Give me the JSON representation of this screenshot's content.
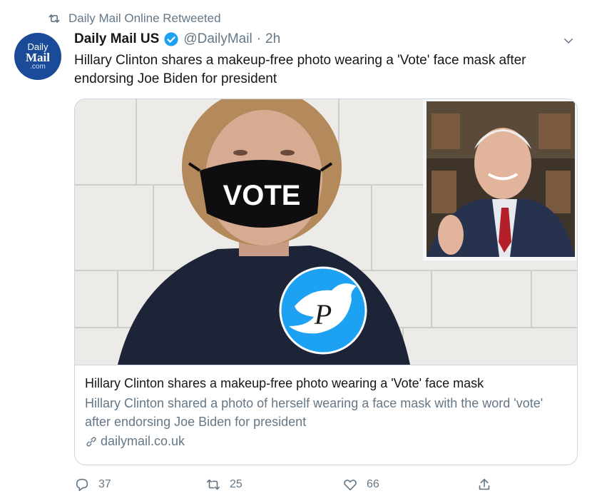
{
  "retweet": {
    "label": "Daily Mail Online Retweeted"
  },
  "avatar": {
    "line1": "Daily",
    "line2": "Mail",
    "line3": ".com"
  },
  "tweet": {
    "author_name": "Daily Mail US",
    "handle": "@DailyMail",
    "separator": "·",
    "time": "2h",
    "text": "Hillary Clinton shares a makeup-free photo wearing a 'Vote' face mask after endorsing Joe Biden for president"
  },
  "card": {
    "title": "Hillary Clinton shares a makeup-free photo wearing a 'Vote' face mask",
    "description": "Hillary Clinton shared a photo of herself wearing a face mask with the word 'vote' after endorsing Joe Biden for president",
    "domain": "dailymail.co.uk",
    "mask_text": "VOTE",
    "watermark_letter": "P"
  },
  "actions": {
    "replies": "37",
    "retweets": "25",
    "likes": "66"
  },
  "colors": {
    "accent": "#1da1f2",
    "secondary_text": "#657786",
    "border": "#ccd6dd",
    "avatar_bg": "#1a4a98"
  },
  "icons": [
    "retweet-icon",
    "verified-icon",
    "chevron-down-icon",
    "link-icon",
    "reply-icon",
    "like-icon",
    "share-icon"
  ]
}
